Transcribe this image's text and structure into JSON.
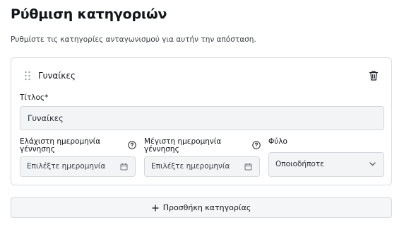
{
  "page": {
    "title": "Ρύθμιση κατηγοριών",
    "description": "Ρυθμίστε τις κατηγορίες ανταγωνισμού για αυτήν την απόσταση."
  },
  "category": {
    "name": "Γυναίκες",
    "title_label": "Τίτλος",
    "title_required": "*",
    "title_value": "Γυναίκες",
    "min_birth_label_line1": "Ελάχιστη ημερομηνία",
    "min_birth_label_line2": "γέννησης",
    "min_birth_placeholder": "Επιλέξτε ημερομηνία",
    "max_birth_label_line1": "Μέγιστη ημερομηνία",
    "max_birth_label_line2": "γέννησης",
    "max_birth_placeholder": "Επιλέξτε ημερομηνία",
    "gender_label": "Φύλο",
    "gender_value": "Οποιοδήποτε"
  },
  "actions": {
    "add_category": "Προσθήκη κατηγορίας"
  },
  "icons": {
    "drag": "drag-handle-icon",
    "delete": "trash-icon",
    "help": "question-circle-icon",
    "calendar": "calendar-icon",
    "dropdown": "chevron-down-icon",
    "add": "plus-icon"
  }
}
